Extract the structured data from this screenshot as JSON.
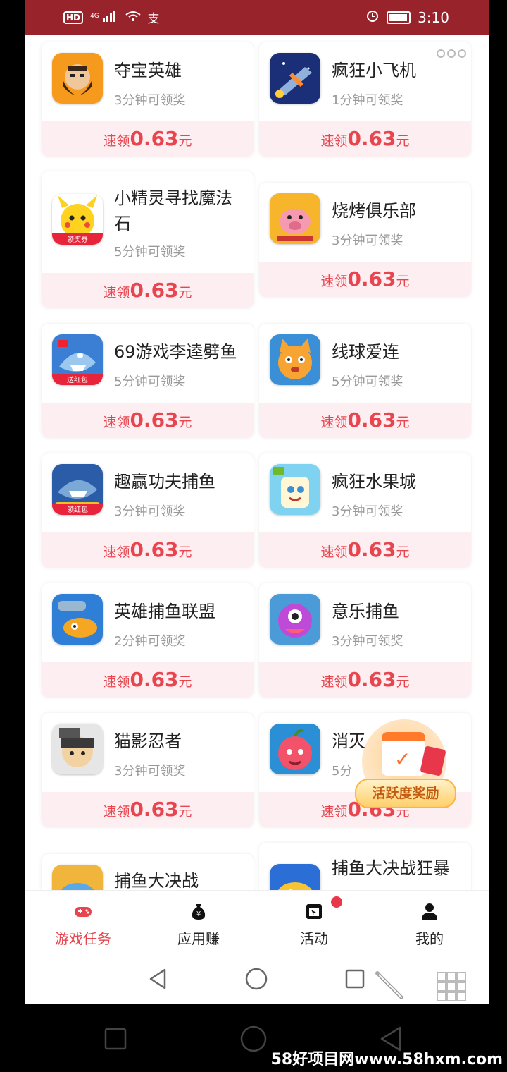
{
  "status_bar": {
    "network_label": "HD",
    "signal_label": "4G",
    "time": "3:10"
  },
  "cards": [
    {
      "name": "夺宝英雄",
      "sub": "3分钟可领奖",
      "reward_prefix": "速领",
      "reward_amount": "0.63",
      "reward_unit": "元",
      "icon": "bearded-hero-icon"
    },
    {
      "name": "疯狂小飞机",
      "sub": "1分钟可领奖",
      "reward_prefix": "速领",
      "reward_amount": "0.63",
      "reward_unit": "元",
      "icon": "fighter-plane-icon"
    },
    {
      "name": "小精灵寻找魔法石",
      "sub": "5分钟可领奖",
      "reward_prefix": "速领",
      "reward_amount": "0.63",
      "reward_unit": "元",
      "icon": "pikachu-icon",
      "icon_badge": "领奖券"
    },
    {
      "name": "烧烤俱乐部",
      "sub": "3分钟可领奖",
      "reward_prefix": "速领",
      "reward_amount": "0.63",
      "reward_unit": "元",
      "icon": "pig-chef-icon"
    },
    {
      "name": "69游戏李逵劈鱼",
      "sub": "5分钟可领奖",
      "reward_prefix": "速领",
      "reward_amount": "0.63",
      "reward_unit": "元",
      "icon": "shark-icon",
      "icon_badge": "送红包"
    },
    {
      "name": "线球爱连",
      "sub": "5分钟可领奖",
      "reward_prefix": "速领",
      "reward_amount": "0.63",
      "reward_unit": "元",
      "icon": "orange-cat-icon"
    },
    {
      "name": "趣赢功夫捕鱼",
      "sub": "3分钟可领奖",
      "reward_prefix": "速领",
      "reward_amount": "0.63",
      "reward_unit": "元",
      "icon": "fish-shark-icon",
      "icon_badge": "领红包"
    },
    {
      "name": "疯狂水果城",
      "sub": "3分钟可领奖",
      "reward_prefix": "速领",
      "reward_amount": "0.63",
      "reward_unit": "元",
      "icon": "fruit-cube-icon"
    },
    {
      "name": "英雄捕鱼联盟",
      "sub": "2分钟可领奖",
      "reward_prefix": "速领",
      "reward_amount": "0.63",
      "reward_unit": "元",
      "icon": "cannon-fish-icon"
    },
    {
      "name": "意乐捕鱼",
      "sub": "3分钟可领奖",
      "reward_prefix": "速领",
      "reward_amount": "0.63",
      "reward_unit": "元",
      "icon": "purple-monster-icon"
    },
    {
      "name": "猫影忍者",
      "sub": "3分钟可领奖",
      "reward_prefix": "速领",
      "reward_amount": "0.63",
      "reward_unit": "元",
      "icon": "ninja-cat-icon"
    },
    {
      "name": "消灭",
      "sub": "5分",
      "reward_prefix": "速领",
      "reward_amount": "0.63",
      "reward_unit": "元",
      "icon": "red-apple-icon"
    },
    {
      "name": "捕鱼大决战",
      "sub": "",
      "reward_prefix": "",
      "reward_amount": "",
      "reward_unit": "",
      "icon": "blue-fish-icon"
    },
    {
      "name": "捕鱼大决战狂暴",
      "sub": "",
      "reward_prefix": "",
      "reward_amount": "",
      "reward_unit": "",
      "icon": "gold-fish-icon"
    }
  ],
  "floating_badge": {
    "label": "活跃度奖励"
  },
  "tabs": [
    {
      "label": "游戏任务",
      "icon": "gamepad-icon",
      "active": true
    },
    {
      "label": "应用赚",
      "icon": "money-bag-icon",
      "active": false
    },
    {
      "label": "活动",
      "icon": "activity-icon",
      "active": false,
      "badge": true
    },
    {
      "label": "我的",
      "icon": "person-icon",
      "active": false
    }
  ],
  "colors": {
    "status_bar": "#98232a",
    "accent": "#e8454f",
    "reward_bg": "#fdeef1"
  },
  "watermark": "58好项目网www.58hxm.com"
}
